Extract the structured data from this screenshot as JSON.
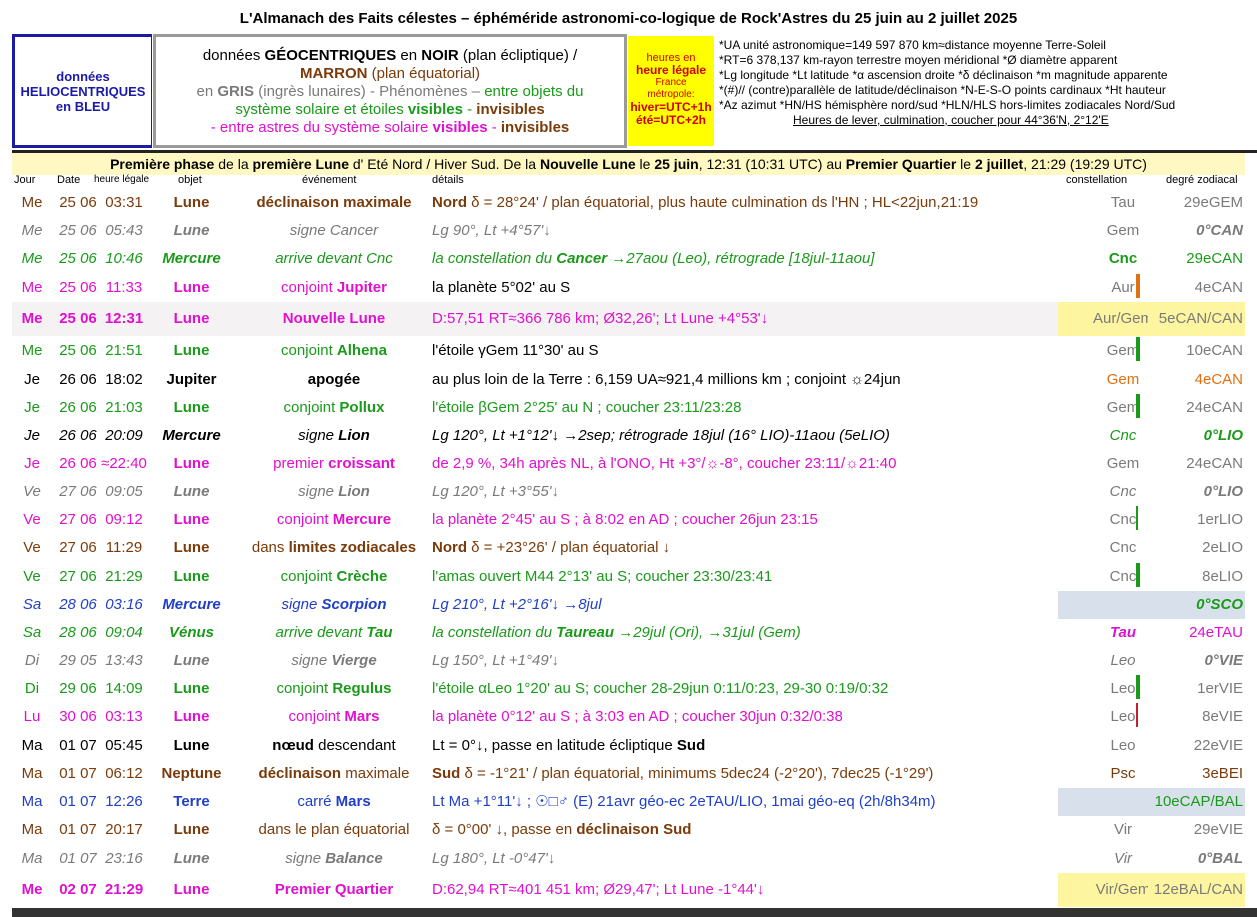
{
  "title": "L'Almanach des Faits célestes – éphéméride astronomi-co-logique de Rock'Astres du 25 juin au 2 juillet 2025",
  "legend": {
    "helio": [
      "données",
      "HELIOCENTRIQUES",
      "en BLEU"
    ],
    "geo": {
      "l1a": "données ",
      "l1b": "GÉOCENTRIQUES",
      "l1c": " en ",
      "l1d": "NOIR",
      "l1e": " (plan écliptique)  /",
      "l2a": "MARRON",
      "l2b": " (plan équatorial)",
      "l3a": "en ",
      "l3b": "GRIS",
      "l3c": " (ingrès lunaires)  -  Phénomènes – ",
      "l3d": "entre objets du",
      "l4a": "système solaire et étoiles ",
      "l4b": "visibles",
      "l4c": " - ",
      "l4d": "invisibles",
      "l5a": "- entre astres du système solaire ",
      "l5b": "visibles",
      "l5c": " - ",
      "l5d": "invisibles"
    },
    "legal": {
      "l1": "heures en",
      "l2": "heure légale",
      "l3": "France",
      "l4": "métropole:",
      "l5": "hiver=UTC+1h",
      "l6": "été=UTC+2h"
    },
    "glossary": [
      "*UA unité astronomique=149 597 870 km≈distance moyenne Terre-Soleil",
      "*RT=6 378,137 km-rayon terrestre moyen méridional   *Ø diamètre apparent",
      "*Lg longitude *Lt latitude   *α ascension droite *δ déclinaison   *m magnitude apparente",
      "*(#)// (contre)parallèle de latitude/déclinaison   *N-E-S-O points cardinaux  *Ht hauteur",
      "*Az azimut   *HN/HS hémisphère nord/sud   *HLN/HLS hors-limites zodiacales Nord/Sud",
      "Heures de lever, culmination, coucher pour 44°36'N, 2°12'E"
    ]
  },
  "phase": {
    "p1": "Première phase",
    "p2": " de la ",
    "p3": "première Lune",
    "p4": " d' Eté Nord / Hiver Sud",
    "p5": ". De la ",
    "p6": "Nouvelle Lune",
    "p7": " le ",
    "p8": "25 juin",
    "p9": ", 12:31 (10:31 UTC) au ",
    "p10": "Premier Quartier",
    "p11": " le ",
    "p12": "2 juillet",
    "p13": ", 21:29 (19:29 UTC)"
  },
  "headers": {
    "jour": "Jour",
    "date": "Date",
    "heure": "heure légale",
    "objet": "objet",
    "event": "événement",
    "details": "détails",
    "const": "constellation",
    "degre": "degré zodiacal"
  },
  "colors": {
    "brown": "#7a3b0a",
    "grey": "#7a7a7a",
    "green": "#1a9a1a",
    "magenta": "#e010d0",
    "blue": "#1f3fc8",
    "black": "#000000",
    "orange": "#e07010",
    "yellow": "#fdf5a0",
    "lightblue": "#d8e0ec"
  },
  "rows": [
    {
      "jour": "Me",
      "date": "25 06",
      "heure": "03:31",
      "objet": "Lune",
      "event": "déclinaison maximale",
      "details": "Nord δ = 28°24' / plan équatorial, plus haute culmination ds l'HN ; HL<22jun,21:19",
      "const": "Tau",
      "degre": "29eGEM"
    },
    {
      "jour": "Me",
      "date": "25 06",
      "heure": "05:43",
      "objet": "Lune",
      "event": "signe Cancer",
      "details": "Lg 90°, Lt +4°57'↓",
      "const": "Gem",
      "degre": "0°CAN"
    },
    {
      "jour": "Me",
      "date": "25 06",
      "heure": "10:46",
      "objet": "Mercure",
      "event": "arrive devant Cnc",
      "details": "la constellation du Cancer →27aou (Leo), rétrograde [18jul-11aou]",
      "const": "Cnc",
      "degre": "29eCAN"
    },
    {
      "jour": "Me",
      "date": "25 06",
      "heure": "11:33",
      "objet": "Lune",
      "event": "conjoint Jupiter",
      "details": "la planète 5°02' au S",
      "const": "Aur",
      "degre": "4eCAN"
    },
    {
      "jour": "Me",
      "date": "25 06",
      "heure": "12:31",
      "objet": "Lune",
      "event": "Nouvelle Lune",
      "details": "D:57,51 RT≈366 786 km; Ø32,26'; Lt Lune +4°53'↓",
      "const": "Aur/Gem",
      "degre": "5eCAN/CAN"
    },
    {
      "jour": "Me",
      "date": "25 06",
      "heure": "21:51",
      "objet": "Lune",
      "event": "conjoint Alhena",
      "details": "l'étoile γGem 11°30' au S",
      "const": "Gem",
      "degre": "10eCAN"
    },
    {
      "jour": "Je",
      "date": "26 06",
      "heure": "18:02",
      "objet": "Jupiter",
      "event": "apogée",
      "details": "au plus loin de la Terre : 6,159 UA≈921,4 millions km ; conjoint ☼24jun",
      "const": "Gem",
      "degre": "4eCAN"
    },
    {
      "jour": "Je",
      "date": "26 06",
      "heure": "21:03",
      "objet": "Lune",
      "event": "conjoint Pollux",
      "details": "l'étoile βGem 2°25' au N ; coucher 23:11/23:28",
      "const": "Gem",
      "degre": "24eCAN"
    },
    {
      "jour": "Je",
      "date": "26 06",
      "heure": "20:09",
      "objet": "Mercure",
      "event": "signe Lion",
      "details": "Lg 120°, Lt +1°12'↓ →2sep; rétrograde 18jul (16° LIO)-11aou (5eLIO)",
      "const": "Cnc",
      "degre": "0°LIO"
    },
    {
      "jour": "Je",
      "date": "26 06",
      "heure": "≈22:40",
      "objet": "Lune",
      "event": "premier croissant",
      "details": "de 2,9 %, 34h après NL, à l'ONO, Ht +3°/☼-8°, coucher 23:11/☼21:40",
      "const": "Gem",
      "degre": "24eCAN"
    },
    {
      "jour": "Ve",
      "date": "27 06",
      "heure": "09:05",
      "objet": "Lune",
      "event": "signe Lion",
      "details": "Lg 120°, Lt +3°55'↓",
      "const": "Cnc",
      "degre": "0°LIO"
    },
    {
      "jour": "Ve",
      "date": "27 06",
      "heure": "09:12",
      "objet": "Lune",
      "event": "conjoint Mercure",
      "details": "la planète 2°45' au S ; à 8:02 en AD ; coucher 26jun 23:15",
      "const": "Cnc",
      "degre": "1erLIO"
    },
    {
      "jour": "Ve",
      "date": "27 06",
      "heure": "11:29",
      "objet": "Lune",
      "event": "dans limites zodiacales",
      "details": "Nord δ = +23°26' / plan équatorial ↓",
      "const": "Cnc",
      "degre": "2eLIO"
    },
    {
      "jour": "Ve",
      "date": "27 06",
      "heure": "21:29",
      "objet": "Lune",
      "event": "conjoint Crèche",
      "details": "l'amas ouvert M44 2°13' au S; coucher 23:30/23:41",
      "const": "Cnc",
      "degre": "8eLIO"
    },
    {
      "jour": "Sa",
      "date": "28 06",
      "heure": "03:16",
      "objet": "Mercure",
      "event": "signe Scorpion",
      "details": "Lg 210°, Lt +2°16'↓ →8jul",
      "const": "",
      "degre": "0°SCO"
    },
    {
      "jour": "Sa",
      "date": "28 06",
      "heure": "09:04",
      "objet": "Vénus",
      "event": "arrive devant Tau",
      "details": "la constellation du Taureau →29jul (Ori), →31jul (Gem)",
      "const": "Tau",
      "degre": "24eTAU"
    },
    {
      "jour": "Di",
      "date": "29 05",
      "heure": "13:43",
      "objet": "Lune",
      "event": "signe Vierge",
      "details": "Lg 150°, Lt +1°49'↓",
      "const": "Leo",
      "degre": "0°VIE"
    },
    {
      "jour": "Di",
      "date": "29 06",
      "heure": "14:09",
      "objet": "Lune",
      "event": "conjoint Regulus",
      "details": "l'étoile αLeo 1°20' au S; coucher 28-29jun 0:11/0:23, 29-30 0:19/0:32",
      "const": "Leo",
      "degre": "1erVIE"
    },
    {
      "jour": "Lu",
      "date": "30 06",
      "heure": "03:13",
      "objet": "Lune",
      "event": "conjoint Mars",
      "details": "la planète 0°12' au S ; à 3:03 en AD ; coucher 30jun 0:32/0:38",
      "const": "Leo",
      "degre": "8eVIE"
    },
    {
      "jour": "Ma",
      "date": "01 07",
      "heure": "05:45",
      "objet": "Lune",
      "event": "nœud descendant",
      "details": "Lt = 0°↓, passe en latitude écliptique Sud",
      "const": "Leo",
      "degre": "22eVIE"
    },
    {
      "jour": "Ma",
      "date": "01 07",
      "heure": "06:12",
      "objet": "Neptune",
      "event": "déclinaison maximale",
      "details": "Sud δ = -1°21' / plan équatorial, minimums 5dec24 (-2°20'), 7dec25 (-1°29')",
      "const": "Psc",
      "degre": "3eBEI"
    },
    {
      "jour": "Ma",
      "date": "01 07",
      "heure": "12:26",
      "objet": "Terre",
      "event": "carré Mars",
      "details": "Lt Ma +1°11'↓ ; ☉□♂ (E) 21avr géo-ec 2eTAU/LIO, 1mai géo-eq (2h/8h34m)",
      "const": "",
      "degre": "10eCAP/BAL"
    },
    {
      "jour": "Ma",
      "date": "01 07",
      "heure": "20:17",
      "objet": "Lune",
      "event": "dans le plan équatorial",
      "details": "δ = 0°00' ↓, passe en déclinaison Sud",
      "const": "Vir",
      "degre": "29eVIE"
    },
    {
      "jour": "Ma",
      "date": "01 07",
      "heure": "23:16",
      "objet": "Lune",
      "event": "signe Balance",
      "details": "Lg 180°, Lt -0°47'↓",
      "const": "Vir",
      "degre": "0°BAL"
    },
    {
      "jour": "Me",
      "date": "02 07",
      "heure": "21:29",
      "objet": "Lune",
      "event": "Premier Quartier",
      "details": "D:62,94 RT≈401 451 km; Ø29,47'; Lt Lune -1°44'↓",
      "const": "Vir/Gem",
      "degre": "12eBAL/CAN"
    }
  ]
}
